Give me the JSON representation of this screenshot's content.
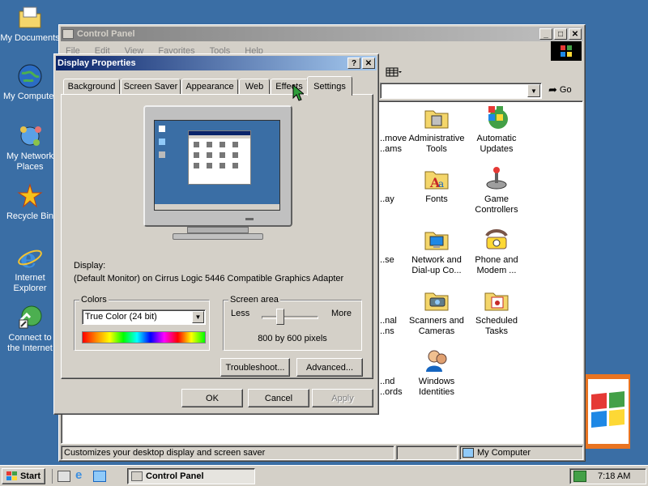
{
  "desktop": {
    "icons": [
      {
        "label_line1": "My Documents",
        "label_line2": ""
      },
      {
        "label_line1": "My Computer",
        "label_line2": ""
      },
      {
        "label_line1": "My Network",
        "label_line2": "Places"
      },
      {
        "label_line1": "Recycle Bin",
        "label_line2": ""
      },
      {
        "label_line1": "Internet",
        "label_line2": "Explorer"
      },
      {
        "label_line1": "Connect to",
        "label_line2": "the Internet"
      }
    ]
  },
  "control_panel": {
    "title": "Control Panel",
    "menu": [
      "File",
      "Edit",
      "View",
      "Favorites",
      "Tools",
      "Help"
    ],
    "go_label": "Go",
    "items": [
      {
        "line1": "...move",
        "line2": "...ams"
      },
      {
        "line1": "Administrative",
        "line2": "Tools"
      },
      {
        "line1": "Automatic",
        "line2": "Updates"
      },
      {
        "line1": "...ay",
        "line2": ""
      },
      {
        "line1": "Fonts",
        "line2": ""
      },
      {
        "line1": "Game",
        "line2": "Controllers"
      },
      {
        "line1": "...se",
        "line2": ""
      },
      {
        "line1": "Network and",
        "line2": "Dial-up Co..."
      },
      {
        "line1": "Phone and",
        "line2": "Modem ..."
      },
      {
        "line1": "...nal",
        "line2": "...ns"
      },
      {
        "line1": "Scanners and",
        "line2": "Cameras"
      },
      {
        "line1": "Scheduled",
        "line2": "Tasks"
      },
      {
        "line1": "...nd",
        "line2": "...ords"
      },
      {
        "line1": "Windows",
        "line2": "Identities"
      }
    ],
    "status_text": "Customizes your desktop display and screen saver",
    "status_zone": "My Computer"
  },
  "dialog": {
    "title": "Display Properties",
    "help_btn": "?",
    "close_btn": "✕",
    "tabs": [
      "Background",
      "Screen Saver",
      "Appearance",
      "Web",
      "Effects",
      "Settings"
    ],
    "active_tab": "Settings",
    "display_label": "Display:",
    "display_value": "(Default Monitor) on Cirrus Logic 5446 Compatible Graphics Adapter",
    "colors_label": "Colors",
    "colors_value": "True Color (24 bit)",
    "screen_area_label": "Screen area",
    "less_label": "Less",
    "more_label": "More",
    "resolution": "800 by 600 pixels",
    "slider_level_percent": 30,
    "troubleshoot_btn": "Troubleshoot...",
    "advanced_btn": "Advanced...",
    "ok_btn": "OK",
    "cancel_btn": "Cancel",
    "apply_btn": "Apply"
  },
  "taskbar": {
    "start_label": "Start",
    "task_label": "Control Panel",
    "clock": "7:18 AM"
  },
  "colors": {
    "desktop": "#3a6ea5",
    "titlebar_active": "#0a246a",
    "face": "#d4d0c8"
  }
}
